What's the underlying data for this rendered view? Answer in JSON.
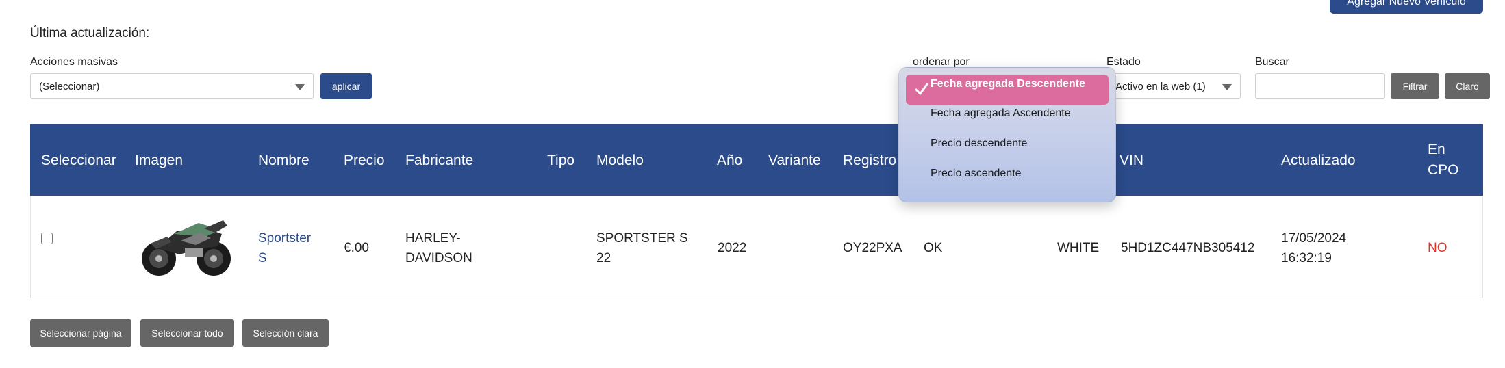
{
  "header": {
    "add_vehicle_label": "Agregar Nuevo Vehículo",
    "last_update_label": "Última actualización:"
  },
  "filters": {
    "bulk_actions_label": "Acciones masivas",
    "bulk_actions_value": "(Seleccionar)",
    "apply_label": "aplicar",
    "order_by_label": "ordenar por",
    "status_label": "Estado",
    "status_value": "Activo en la web (1)",
    "search_label": "Buscar",
    "search_value": "",
    "filter_label": "Filtrar",
    "clear_label": "Claro"
  },
  "sort_dropdown": {
    "options": [
      "Fecha agregada Descendente",
      "Fecha agregada Ascendente",
      "Precio descendente",
      "Precio ascendente"
    ],
    "selected_index": 0,
    "selected_color": "#dc6c9e"
  },
  "table": {
    "headers": {
      "select": "Seleccionar",
      "image": "Imagen",
      "name": "Nombre",
      "price": "Precio",
      "manufacturer": "Fabricante",
      "type": "Tipo",
      "model": "Modelo",
      "year": "Año",
      "variant": "Variante",
      "registration": "Registro",
      "vin": "VIN",
      "updated": "Actualizado",
      "cpo_line1": "En",
      "cpo_line2": "CPO"
    },
    "header_color": "#2b4b8b",
    "rows": [
      {
        "checked": false,
        "image": "motorcycle-thumbnail",
        "name_line1": "Sportster",
        "name_line2": "S",
        "price": "€.00",
        "manufacturer_line1": "HARLEY-",
        "manufacturer_line2": "DAVIDSON",
        "type": "",
        "model_line1": "SPORTSTER S",
        "model_line2": "22",
        "year": "2022",
        "variant": "",
        "registration": "OY22PXA",
        "status": "OK",
        "color": "WHITE",
        "vin": "5HD1ZC447NB305412",
        "updated_line1": "17/05/2024",
        "updated_line2": "16:32:19",
        "cpo": "NO"
      }
    ]
  },
  "footer": {
    "select_page_label": "Seleccionar página",
    "select_all_label": "Seleccionar todo",
    "clear_selection_label": "Selección clara"
  }
}
